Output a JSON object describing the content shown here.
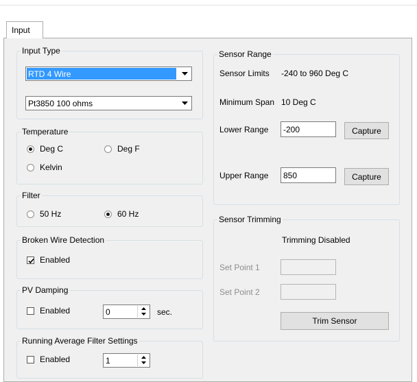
{
  "tabs": [
    {
      "label": "Input"
    }
  ],
  "input_type": {
    "title": "Input Type",
    "wire_select": {
      "value": "RTD 4 Wire"
    },
    "sensor_select": {
      "value": "Pt3850 100 ohms"
    }
  },
  "temperature": {
    "title": "Temperature",
    "options": [
      {
        "label": "Deg C",
        "selected": true
      },
      {
        "label": "Deg F",
        "selected": false
      },
      {
        "label": "Kelvin",
        "selected": false
      }
    ]
  },
  "filter": {
    "title": "Filter",
    "options": [
      {
        "label": "50 Hz",
        "selected": false
      },
      {
        "label": "60 Hz",
        "selected": true
      }
    ]
  },
  "broken_wire": {
    "title": "Broken Wire Detection",
    "enabled_label": "Enabled",
    "checked": true
  },
  "pv_damping": {
    "title": "PV Damping",
    "enabled_label": "Enabled",
    "checked": false,
    "value": "0",
    "unit": "sec."
  },
  "running_avg": {
    "title": "Running Average Filter Settings",
    "enabled_label": "Enabled",
    "checked": false,
    "value": "1"
  },
  "sensor_range": {
    "title": "Sensor Range",
    "limits_label": "Sensor Limits",
    "limits_value": "-240 to 960 Deg C",
    "min_span_label": "Minimum Span",
    "min_span_value": "10 Deg C",
    "lower_label": "Lower Range",
    "lower_value": "-200",
    "upper_label": "Upper Range",
    "upper_value": "850",
    "capture_label": "Capture"
  },
  "sensor_trimming": {
    "title": "Sensor Trimming",
    "status": "Trimming Disabled",
    "set_point_1_label": "Set Point 1",
    "set_point_2_label": "Set Point 2",
    "trim_button": "Trim Sensor"
  }
}
